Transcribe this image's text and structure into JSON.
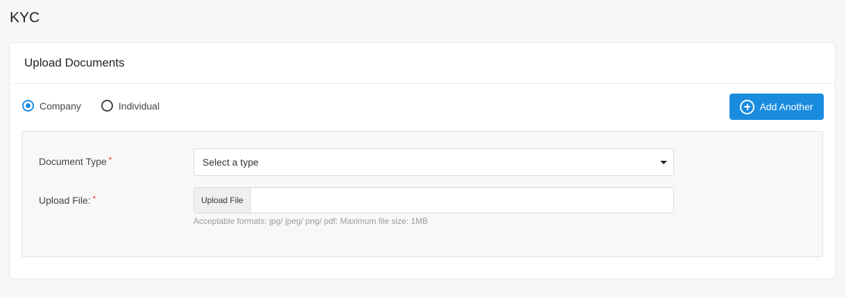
{
  "page": {
    "title": "KYC"
  },
  "card": {
    "title": "Upload Documents",
    "entity_type": {
      "options": [
        {
          "label": "Company",
          "selected": true
        },
        {
          "label": "Individual",
          "selected": false
        }
      ]
    },
    "add_button": {
      "label": "Add Another",
      "icon": "plus-circle-icon"
    },
    "document": {
      "type_label": "Document Type",
      "type_placeholder": "Select a type",
      "file_label": "Upload File:",
      "file_button": "Upload File",
      "file_value": "",
      "help_text": "Acceptable formats: jpg/ jpeg/ png/ pdf: Maximum file size: 1MB",
      "required_marker": "*"
    }
  },
  "colors": {
    "accent": "#1a8ce0",
    "required": "#e02020",
    "background": "#f7f7f7"
  }
}
